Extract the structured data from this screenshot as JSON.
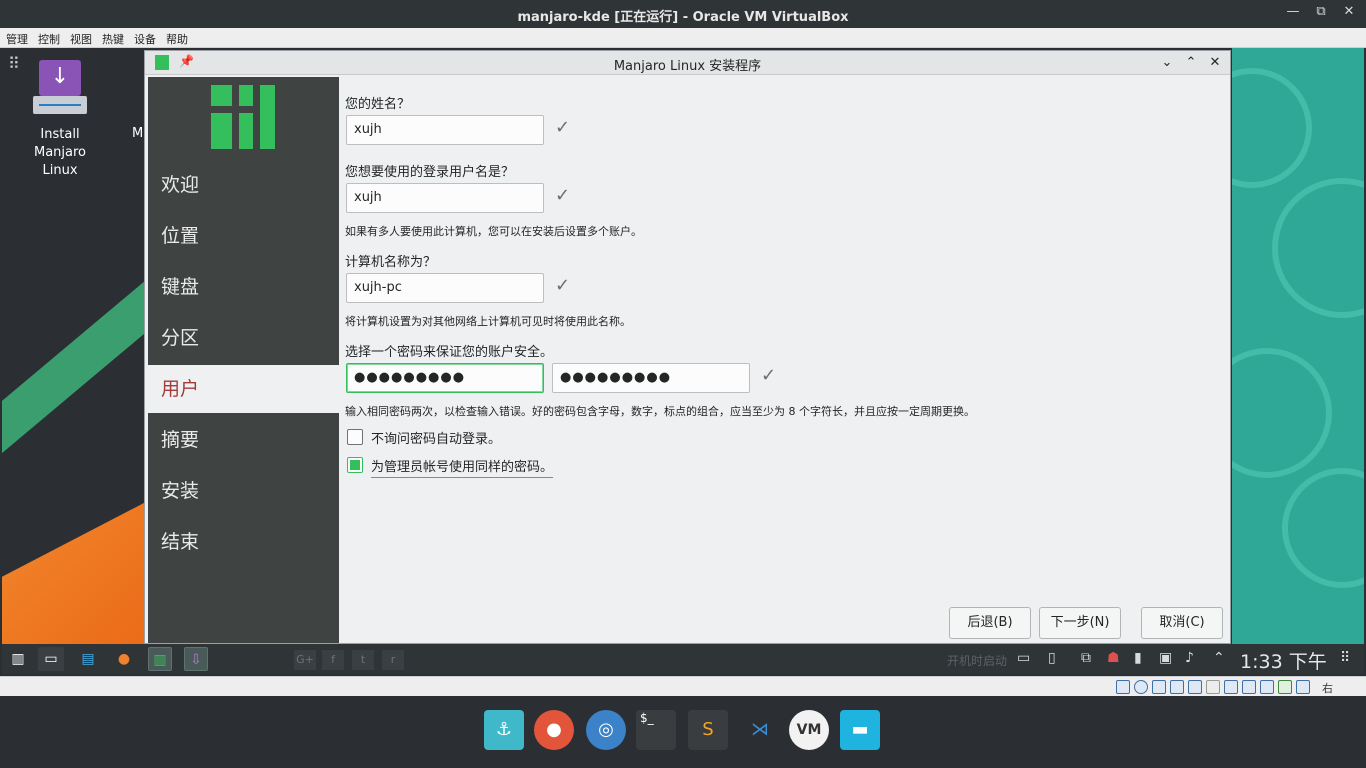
{
  "host": {
    "window_title": "manjaro-kde [正在运行] - Oracle VM VirtualBox",
    "menu": [
      "管理",
      "控制",
      "视图",
      "热键",
      "设备",
      "帮助"
    ],
    "controls": {
      "minimize": "—",
      "restore": "⧉",
      "close": "✕"
    },
    "hostkey": "右 Ctrl"
  },
  "desktop": {
    "icon_label": "Install\nManjaro Linux",
    "partial_label": "M"
  },
  "installer": {
    "title": "Manjaro Linux 安装程序",
    "nav": [
      "欢迎",
      "位置",
      "键盘",
      "分区",
      "用户",
      "摘要",
      "安装",
      "结束"
    ],
    "active_nav": "用户",
    "name_label": "您的姓名？",
    "name_value": "xujh",
    "login_label": "您想要使用的登录用户名是？",
    "login_value": "xujh",
    "login_hint": "如果有多人要使用此计算机，您可以在安装后设置多个账户。",
    "host_label": "计算机名称为？",
    "host_value": "xujh-pc",
    "host_hint": "将计算机设置为对其他网络上计算机可见时将使用此名称。",
    "pw_label": "选择一个密码来保证您的账户安全。",
    "pw_value": "●●●●●●●●●",
    "pw_confirm": "●●●●●●●●●",
    "pw_hint": "输入相同密码两次，以检查输入错误。好的密码包含字母，数字，标点的组合，应当至少为 8 个字符长，并且应按一定周期更换。",
    "autologin_label": "不询问密码自动登录。",
    "autologin_checked": false,
    "admin_same_label": "为管理员帐号使用同样的密码。",
    "admin_same_checked": true,
    "back_label": "后退(B)",
    "next_label": "下一步(N)",
    "cancel_label": "取消(C)"
  },
  "taskbar": {
    "autostart": "开机时启动",
    "clock": "1:33 下午"
  },
  "colors": {
    "accent": "#35bf5c",
    "sidebar": "#3f4443",
    "active_nav_text": "#a43b3b"
  }
}
